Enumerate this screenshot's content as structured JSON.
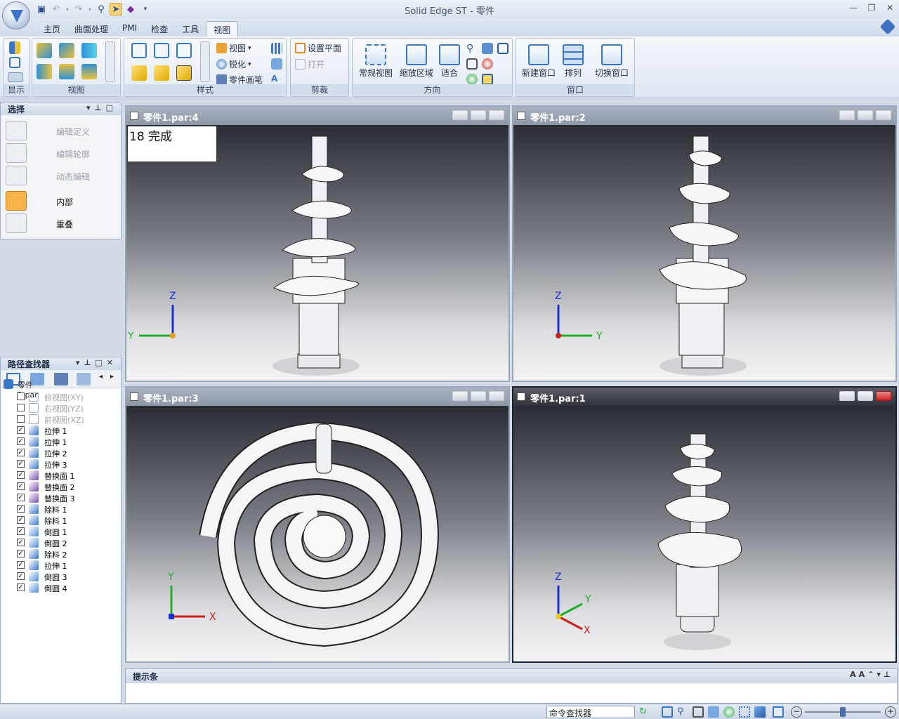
{
  "window": {
    "title": "Solid Edge ST - 零件"
  },
  "tabs": [
    "主页",
    "曲面处理",
    "PMI",
    "检查",
    "工具",
    "视图"
  ],
  "active_tab": "视图",
  "ribbon": {
    "groups": {
      "display": "显示",
      "views": "视图",
      "styles": "样式",
      "clip": "剪裁",
      "orient": "方向",
      "window": "窗口"
    },
    "style_items": {
      "view": "视图",
      "sharpen": "锐化",
      "part_painter": "零件画笔"
    },
    "clip_items": {
      "set_plane": "设置平面",
      "open": "打开"
    },
    "orient_buttons": {
      "normal_view": "常规视图",
      "zoom_area": "缩放区域",
      "fit": "适合"
    },
    "window_buttons": {
      "new_window": "新建窗口",
      "arrange": "排列",
      "switch_window": "切换窗口"
    }
  },
  "select_panel": {
    "title": "选择",
    "items": [
      {
        "label": "编辑定义",
        "enabled": false
      },
      {
        "label": "编辑轮廓",
        "enabled": false
      },
      {
        "label": "动态编辑",
        "enabled": false
      },
      {
        "label": "内部",
        "enabled": true
      },
      {
        "label": "重叠",
        "enabled": true
      }
    ]
  },
  "pathfinder": {
    "title": "路径查找器",
    "root": "零件1.par",
    "items": [
      {
        "label": "俯视图(XY)",
        "checked": false,
        "enabled": false
      },
      {
        "label": "右视图(YZ)",
        "checked": false,
        "enabled": false
      },
      {
        "label": "前视图(XZ)",
        "checked": false,
        "enabled": false
      },
      {
        "label": "拉伸 1",
        "checked": true,
        "enabled": true
      },
      {
        "label": "拉伸 1",
        "checked": true,
        "enabled": true
      },
      {
        "label": "拉伸 2",
        "checked": true,
        "enabled": true
      },
      {
        "label": "拉伸 3",
        "checked": true,
        "enabled": true
      },
      {
        "label": "替换面 1",
        "checked": true,
        "enabled": true
      },
      {
        "label": "替换面 2",
        "checked": true,
        "enabled": true
      },
      {
        "label": "替换面 3",
        "checked": true,
        "enabled": true
      },
      {
        "label": "除料 1",
        "checked": true,
        "enabled": true
      },
      {
        "label": "除料 1",
        "checked": true,
        "enabled": true
      },
      {
        "label": "倒圆 1",
        "checked": true,
        "enabled": true
      },
      {
        "label": "倒圆 2",
        "checked": true,
        "enabled": true
      },
      {
        "label": "除料 2",
        "checked": true,
        "enabled": true
      },
      {
        "label": "拉伸 1",
        "checked": true,
        "enabled": true
      },
      {
        "label": "倒圆 3",
        "checked": true,
        "enabled": true
      },
      {
        "label": "倒圆 4",
        "checked": true,
        "enabled": true
      }
    ]
  },
  "viewports": [
    {
      "title": "零件1.par:4",
      "overlay": "18 完成",
      "axes": "Z Y",
      "active": false
    },
    {
      "title": "零件1.par:2",
      "axes": "Z Y",
      "active": false
    },
    {
      "title": "零件1.par:3",
      "axes": "Y X",
      "active": false
    },
    {
      "title": "零件1.par:1",
      "axes": "Z Y X",
      "active": true
    }
  ],
  "axis_labels": {
    "x": "X",
    "y": "Y",
    "z": "Z"
  },
  "prompt_bar": {
    "title": "提示条"
  },
  "status_bar": {
    "command_finder": "命令查找器"
  },
  "colors": {
    "accent": "#3a76c8",
    "highlight": "#f7b24a",
    "axis_x": "#d01c1c",
    "axis_y": "#1fae2a",
    "axis_z": "#1c2fd0"
  }
}
